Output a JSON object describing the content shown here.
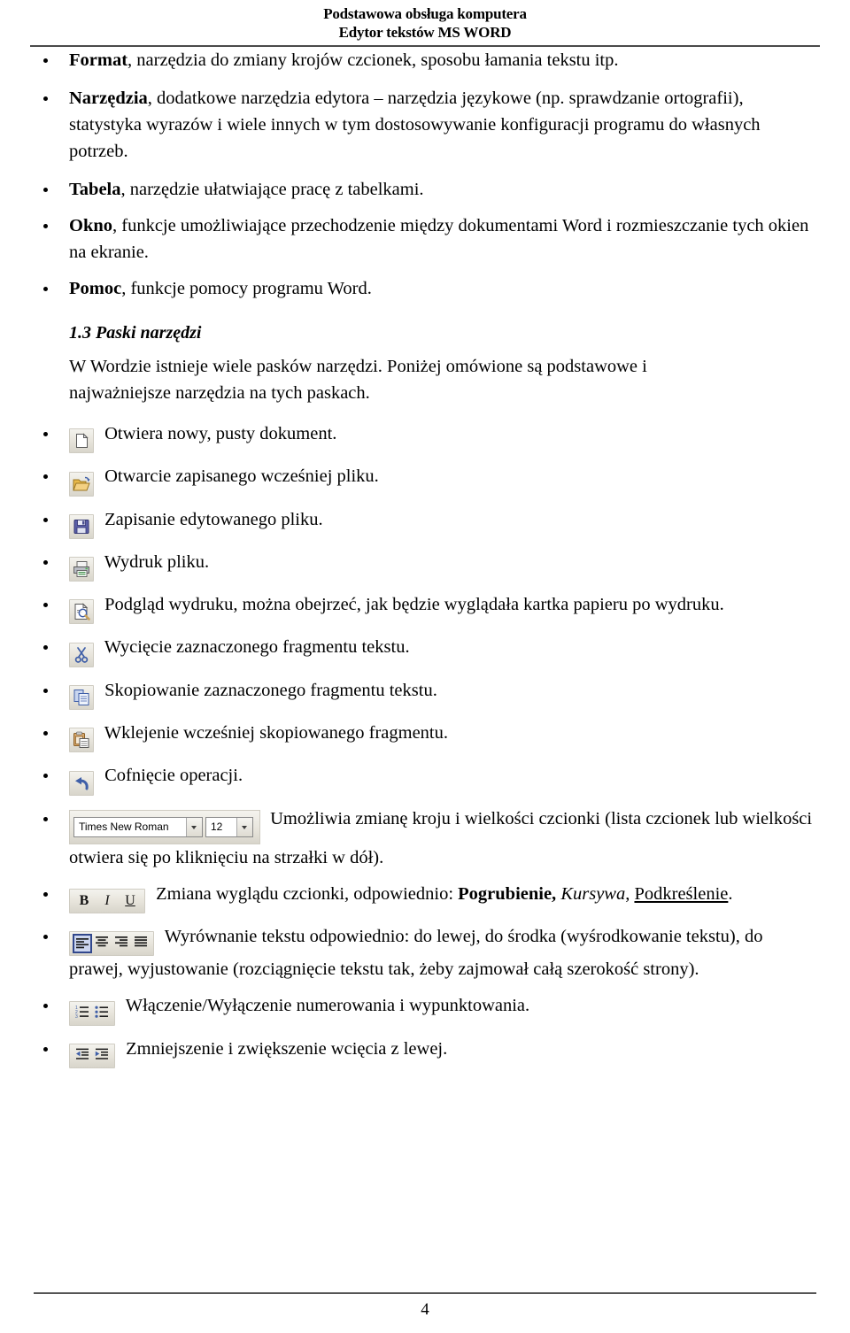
{
  "header": {
    "line1": "Podstawowa obsługa komputera",
    "line2": "Edytor tekstów MS WORD"
  },
  "menu_bullets": [
    {
      "term": "Format",
      "rest": ", narzędzia do zmiany krojów czcionek, sposobu łamania tekstu itp."
    },
    {
      "term": "Narzędzia",
      "rest": ", dodatkowe narzędzia edytora – narzędzia językowe (np. sprawdzanie ortografii), statystyka wyrazów i wiele innych w tym dostosowywanie konfiguracji programu do własnych potrzeb."
    },
    {
      "term": "Tabela",
      "rest": ", narzędzie ułatwiające pracę z tabelkami."
    },
    {
      "term": "Okno",
      "rest": ", funkcje umożliwiające przechodzenie między dokumentami Word i rozmieszczanie tych okien na ekranie."
    },
    {
      "term": "Pomoc",
      "rest": ", funkcje pomocy programu Word."
    }
  ],
  "section": {
    "number": "1.3",
    "title": "Paski narzędzi",
    "paragraph": "W Wordzie istnieje wiele pasków narzędzi. Poniżej omówione są podstawowe i najważniejsze narzędzia na tych paskach."
  },
  "toolbar_items": [
    {
      "icon": "new-document-icon",
      "text": "Otwiera nowy, pusty dokument."
    },
    {
      "icon": "open-folder-icon",
      "text": "Otwarcie zapisanego wcześniej pliku."
    },
    {
      "icon": "save-floppy-icon",
      "text": "Zapisanie edytowanego pliku."
    },
    {
      "icon": "print-icon",
      "text": "Wydruk pliku."
    },
    {
      "icon": "print-preview-icon",
      "text": "Podgląd wydruku, można obejrzeć, jak będzie wyglądała kartka papieru po wydruku."
    },
    {
      "icon": "cut-scissors-icon",
      "text": "Wycięcie zaznaczonego fragmentu tekstu."
    },
    {
      "icon": "copy-icon",
      "text": "Skopiowanie zaznaczonego fragmentu tekstu."
    },
    {
      "icon": "paste-clipboard-icon",
      "text": "Wklejenie wcześniej skopiowanego fragmentu."
    },
    {
      "icon": "undo-arrow-icon",
      "text": "Cofnięcie operacji."
    }
  ],
  "font_combo": {
    "font_name_value": "Times New Roman",
    "font_size_value": "12",
    "description": "Umożliwia zmianę kroju i wielkości czcionki (lista czcionek lub wielkości otwiera się po kliknięciu na strzałki w dół)."
  },
  "style_buttons": {
    "bold_label": "B",
    "italic_label": "I",
    "underline_label": "U",
    "desc_prefix": "Zmiana wyglądu czcionki, odpowiednio: ",
    "bold_word": "Pogrubienie,",
    "italic_word": "Kursywa",
    "comma": ", ",
    "underline_word": "Podkreślenie",
    "desc_suffix": "."
  },
  "align_buttons": {
    "icons": [
      "align-left-icon",
      "align-center-icon",
      "align-right-icon",
      "align-justify-icon"
    ],
    "active_index": 0,
    "description": "Wyrównanie tekstu odpowiednio: do lewej, do środka (wyśrodkowanie tekstu), do prawej, wyjustowanie (rozciągnięcie tekstu tak, żeby zajmował całą szerokość strony)."
  },
  "list_buttons": {
    "icons": [
      "numbered-list-icon",
      "bulleted-list-icon"
    ],
    "description": "Włączenie/Wyłączenie numerowania i wypunktowania."
  },
  "indent_buttons": {
    "icons": [
      "decrease-indent-icon",
      "increase-indent-icon"
    ],
    "description": "Zmniejszenie i zwiększenie wcięcia z lewej."
  },
  "footer": {
    "page_number": "4"
  },
  "colors": {
    "rule": "#4a4a4a",
    "toolbar_face": "#e6e3da",
    "active_border": "#31478c",
    "folder_yellow": "#e8b94a",
    "floppy_blue": "#5b5fa8",
    "icon_blue": "#3f5fa8"
  }
}
